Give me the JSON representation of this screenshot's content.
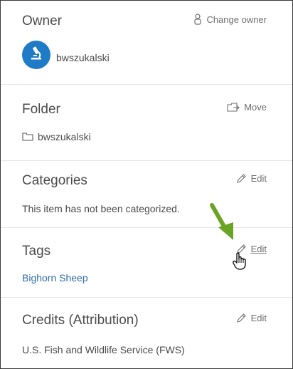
{
  "owner": {
    "heading": "Owner",
    "action_label": "Change owner",
    "action_icon": "person-icon",
    "username": "bwszukalski",
    "avatar_icon": "microscope-icon",
    "avatar_color": "#1f7bc6"
  },
  "folder": {
    "heading": "Folder",
    "action_label": "Move",
    "action_icon": "move-icon",
    "folder_icon": "folder-icon",
    "folder_name": "bwszukalski"
  },
  "categories": {
    "heading": "Categories",
    "action_label": "Edit",
    "action_icon": "pencil-icon",
    "body": "This item has not been categorized."
  },
  "tags": {
    "heading": "Tags",
    "action_label": "Edit",
    "action_icon": "pencil-icon",
    "items": [
      "Bighorn Sheep"
    ],
    "link_color": "#2e6fa8"
  },
  "credits": {
    "heading": "Credits (Attribution)",
    "action_label": "Edit",
    "action_icon": "pencil-icon",
    "body": "U.S. Fish and Wildlife Service (FWS)"
  },
  "annotation": {
    "arrow_icon": "green-arrow-icon",
    "arrow_color": "#6aa424",
    "cursor_icon": "hand-cursor-icon"
  }
}
